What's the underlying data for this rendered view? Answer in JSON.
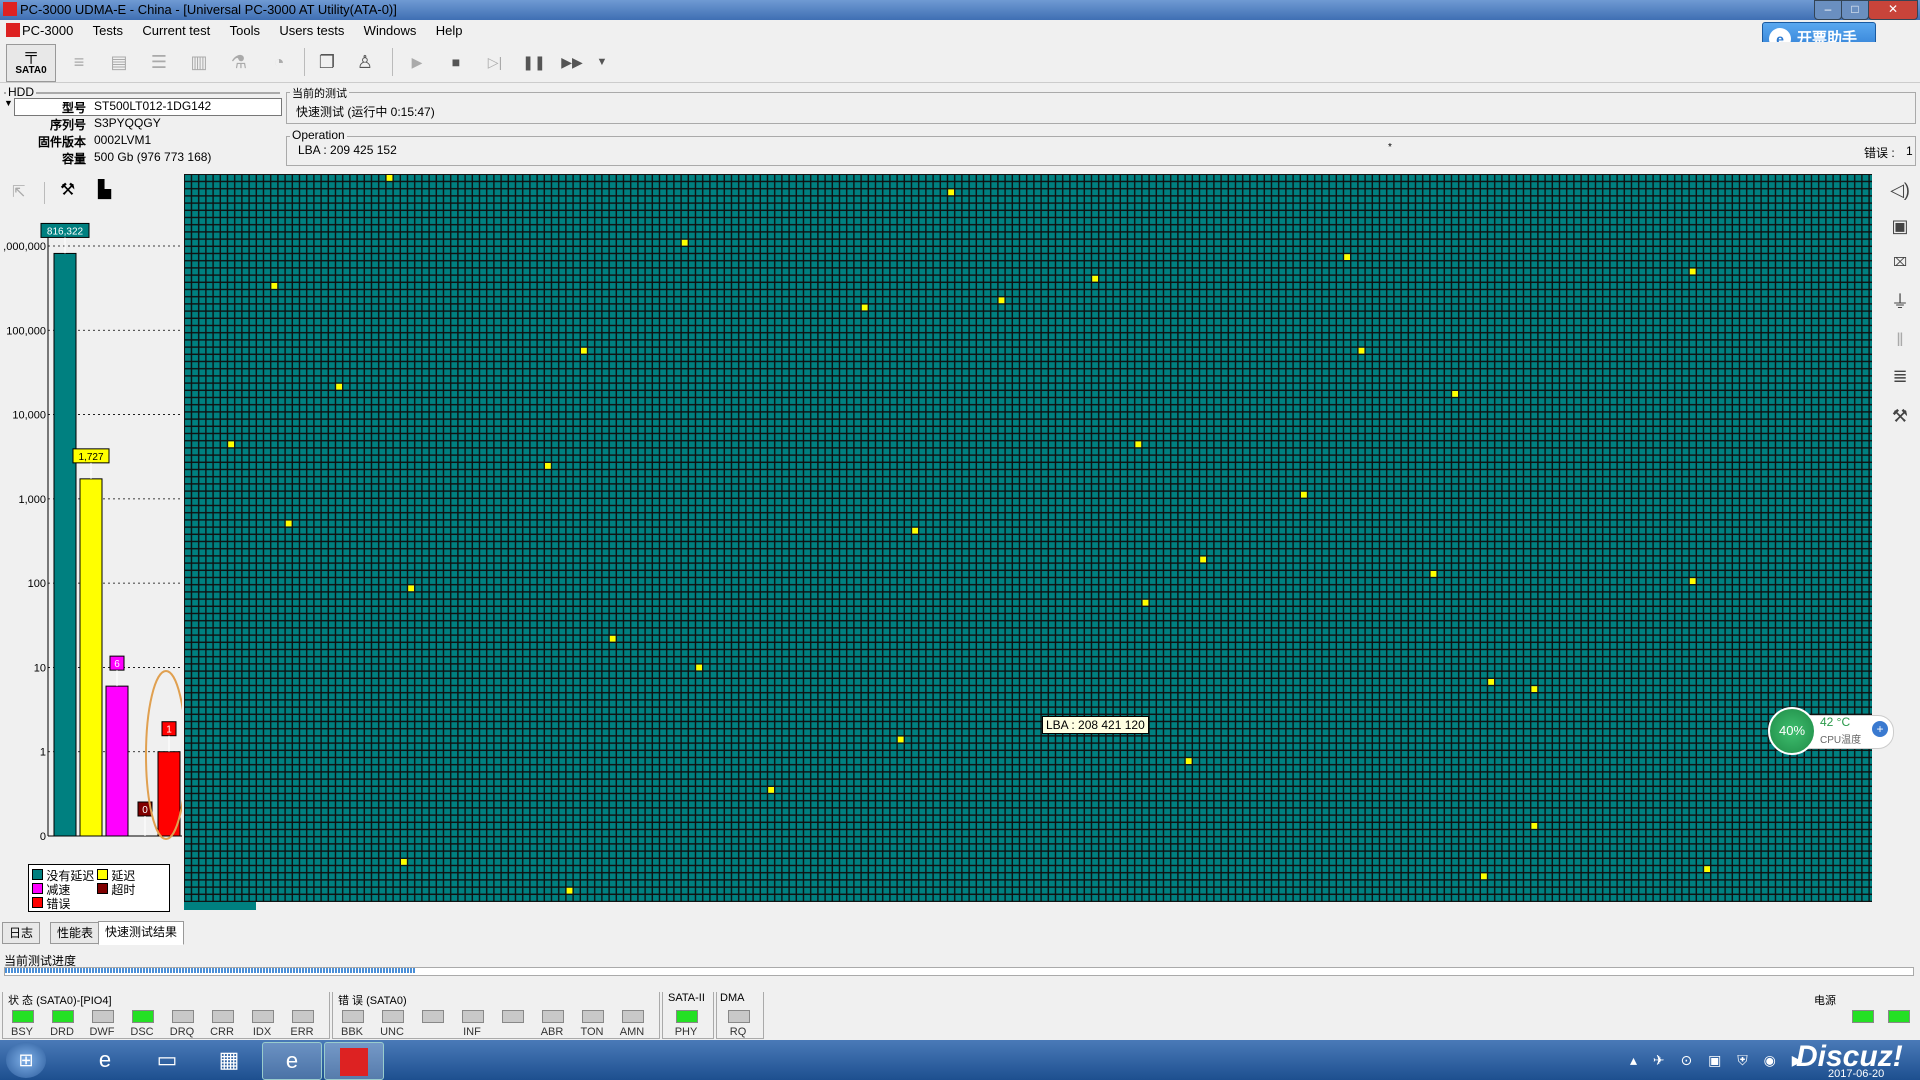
{
  "window": {
    "title": "PC-3000 UDMA-E - China - [Universal PC-3000 AT Utility(ATA-0)]",
    "min": "–",
    "max": "□",
    "close": "✕"
  },
  "menu": [
    "PC-3000",
    "Tests",
    "Current test",
    "Tools",
    "Users tests",
    "Windows",
    "Help"
  ],
  "helper_button": {
    "label": "开票助手"
  },
  "toolbar": {
    "sata_label": "SATA0"
  },
  "hdd": {
    "group_label": "HDD",
    "rows": [
      {
        "key": "型号",
        "value": "ST500LT012-1DG142"
      },
      {
        "key": "序列号",
        "value": "S3PYQQGY"
      },
      {
        "key": "固件版本",
        "value": "0002LVM1"
      },
      {
        "key": "容量",
        "value": "500 Gb (976 773 168)"
      }
    ]
  },
  "current_test": {
    "group_label": "当前的测试",
    "text": "快速测试 (运行中 0:15:47)"
  },
  "operation": {
    "group_label": "Operation",
    "lba": "LBA : 209 425 152",
    "errors_label": "错误 :",
    "errors_value": "1"
  },
  "chart_data": {
    "type": "bar",
    "yscale": "log",
    "ytick_labels": [
      ",000,000",
      "100,000",
      "10,000",
      "1,000",
      "100",
      "10",
      "1",
      "0"
    ],
    "bars": [
      {
        "name": "没有延迟",
        "value": 816322,
        "label": "816,322",
        "color": "#008080"
      },
      {
        "name": "延迟",
        "value": 1727,
        "label": "1,727",
        "color": "#ffff00"
      },
      {
        "name": "减速",
        "value": 6,
        "label": "6",
        "color": "#ff00ff"
      },
      {
        "name": "超时",
        "value": 0,
        "label": "0",
        "color": "#800000"
      },
      {
        "name": "错误",
        "value": 1,
        "label": "1",
        "color": "#ff0000"
      }
    ],
    "legend": [
      {
        "label": "没有延迟",
        "color": "#008080"
      },
      {
        "label": "延迟",
        "color": "#ffff00"
      },
      {
        "label": "减速",
        "color": "#ff00ff"
      },
      {
        "label": "超时",
        "color": "#800000"
      },
      {
        "label": "错误",
        "color": "#ff0000"
      }
    ]
  },
  "grid_map": {
    "cell_color": "#008080",
    "line_color": "#101010",
    "slow_color": "#ffff00",
    "tooltip": "LBA : 208 421 120"
  },
  "tabs": [
    "日志",
    "性能表",
    "快速测试结果"
  ],
  "active_tab": "快速测试结果",
  "progress": {
    "label": "当前测试进度"
  },
  "status": {
    "state_group": "状 态 (SATA0)-[PIO4]",
    "state": [
      {
        "label": "BSY",
        "on": true
      },
      {
        "label": "DRD",
        "on": true
      },
      {
        "label": "DWF",
        "on": false
      },
      {
        "label": "DSC",
        "on": true
      },
      {
        "label": "DRQ",
        "on": false
      },
      {
        "label": "CRR",
        "on": false
      },
      {
        "label": "IDX",
        "on": false
      },
      {
        "label": "ERR",
        "on": false
      }
    ],
    "error_group": "错 误 (SATA0)",
    "errors": [
      {
        "label": "BBK"
      },
      {
        "label": "UNC"
      },
      {
        "label": ""
      },
      {
        "label": "INF"
      },
      {
        "label": ""
      },
      {
        "label": "ABR"
      },
      {
        "label": "TON"
      },
      {
        "label": "AMN"
      }
    ],
    "sata_group": "SATA-II",
    "sata": {
      "label": "PHY",
      "on": true
    },
    "dma_group": "DMA",
    "dma": {
      "label": "RQ",
      "on": false
    },
    "power_group": "电源"
  },
  "cpu": {
    "percent": "40%",
    "temp": "42 °C",
    "label": "CPU温度"
  },
  "taskbar": {
    "watermark": "Discuz!",
    "date": "2017-06-20"
  }
}
